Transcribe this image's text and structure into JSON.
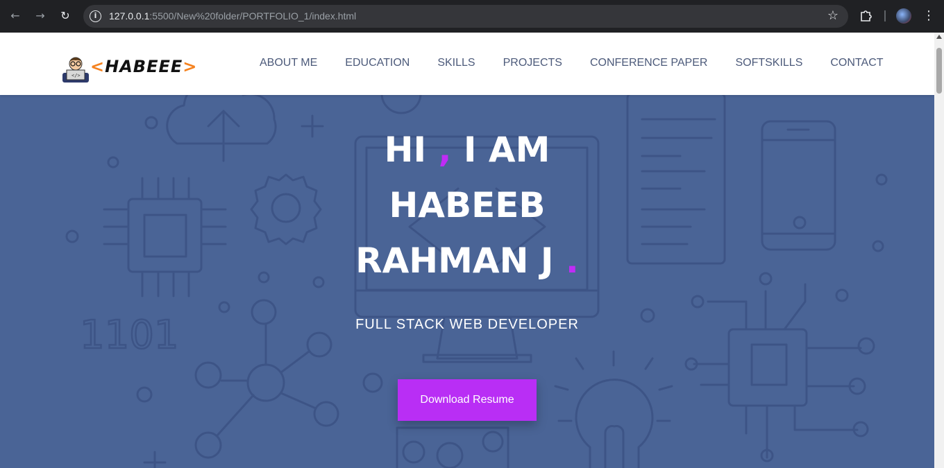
{
  "browser": {
    "url_host": "127.0.0.1",
    "url_rest": ":5500/New%20folder/PORTFOLIO_1/index.html",
    "icons": [
      "back-icon",
      "forward-icon",
      "reload-icon",
      "info-icon",
      "star-icon",
      "extensions-icon",
      "profile-avatar",
      "kebab-menu-icon"
    ]
  },
  "navbar": {
    "logo_open": "<",
    "logo_name": "HABEEE",
    "logo_close": ">",
    "links": [
      "ABOUT ME",
      "EDUCATION",
      "SKILLS",
      "PROJECTS",
      "CONFERENCE PAPER",
      "SOFTSKILLS",
      "CONTACT"
    ]
  },
  "hero": {
    "line1_a": "HI ",
    "line1_comma": ",",
    "line1_b": " I AM",
    "line2": "HABEEB",
    "line3": "RAHMAN J ",
    "line3_dot": ".",
    "subtitle": "FULL STACK WEB DEVELOPER",
    "button": "Download Resume",
    "bg_text": "1101"
  },
  "colors": {
    "accent": "#c02cf5",
    "button": "#b92ef5",
    "hero_bg": "#4a6496",
    "nav_link": "#4c5a7a",
    "logo_bracket": "#f5821f"
  }
}
